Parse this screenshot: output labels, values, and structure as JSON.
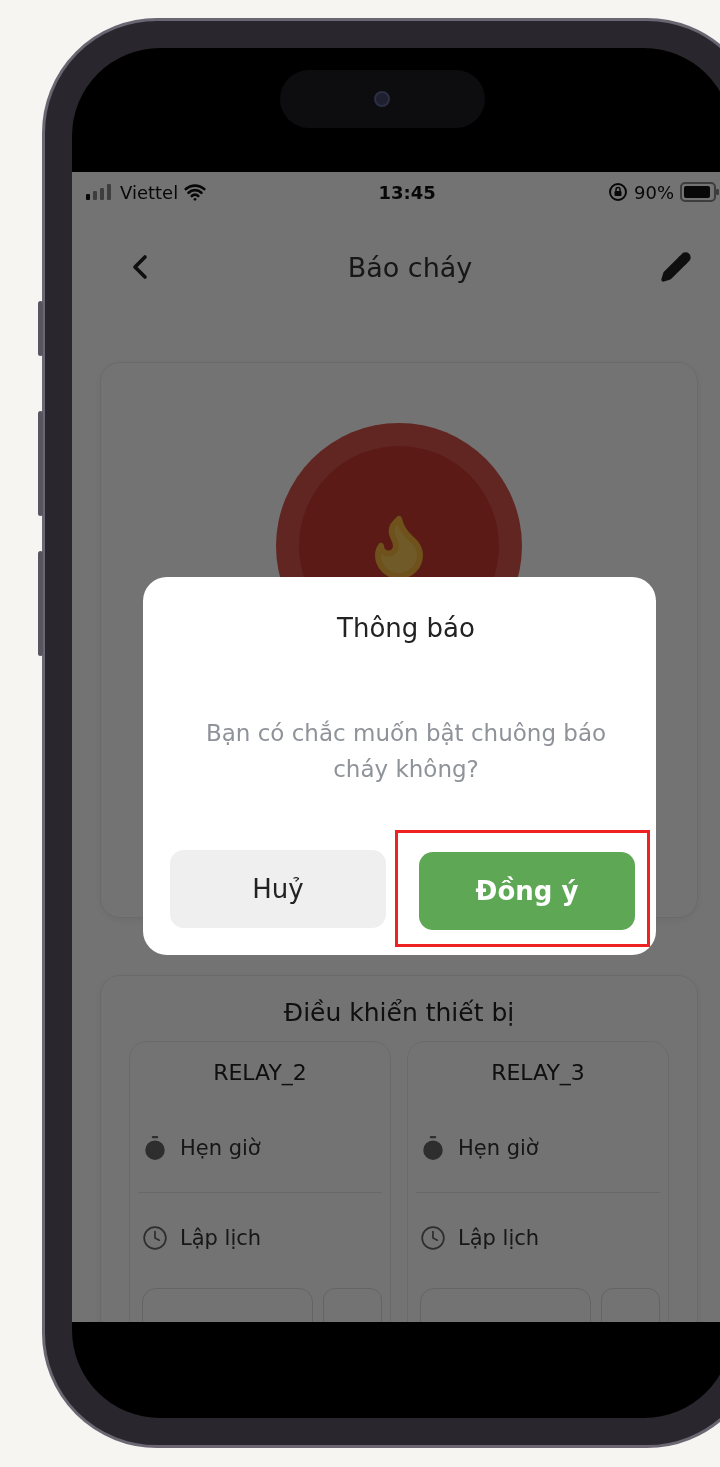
{
  "status_bar": {
    "carrier": "Viettel",
    "time": "13:45",
    "battery": "90%"
  },
  "header": {
    "title": "Báo cháy"
  },
  "device_control": {
    "title": "Điều khiển thiết bị",
    "relays": [
      {
        "name": "RELAY_2",
        "options": [
          {
            "kind": "timer",
            "label": "Hẹn giờ"
          },
          {
            "kind": "schedule",
            "label": "Lập lịch"
          }
        ]
      },
      {
        "name": "RELAY_3",
        "options": [
          {
            "kind": "timer",
            "label": "Hẹn giờ"
          },
          {
            "kind": "schedule",
            "label": "Lập lịch"
          }
        ]
      }
    ]
  },
  "dialog": {
    "title": "Thông báo",
    "message": "Bạn có chắc muốn bật chuông báo cháy không?",
    "buttons": [
      {
        "kind": "secondary",
        "label": "Huỷ",
        "highlighted": false
      },
      {
        "kind": "primary",
        "label": "Đồng ý",
        "highlighted": true
      }
    ]
  }
}
